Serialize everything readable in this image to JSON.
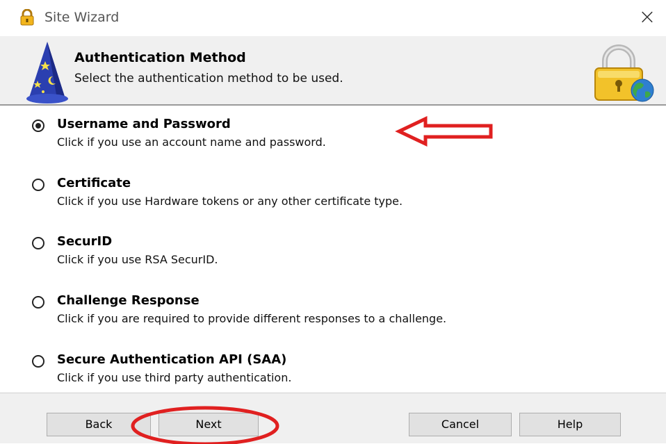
{
  "window": {
    "title": "Site Wizard",
    "close_glyph": "×"
  },
  "header": {
    "title": "Authentication Method",
    "subtitle": "Select the authentication method to be used.",
    "left_icon": "wizard-hat-icon",
    "right_icon": "lock-globe-icon"
  },
  "options": [
    {
      "label": "Username and Password",
      "description": "Click if you use an account name and password.",
      "selected": true
    },
    {
      "label": "Certificate",
      "description": "Click if you use Hardware tokens or any other certificate type.",
      "selected": false
    },
    {
      "label": "SecurID",
      "description": "Click if you use RSA SecurID.",
      "selected": false
    },
    {
      "label": "Challenge Response",
      "description": "Click if you are required to provide different responses to a challenge.",
      "selected": false
    },
    {
      "label": "Secure Authentication API (SAA)",
      "description": "Click if you use third party authentication.",
      "selected": false
    }
  ],
  "buttons": {
    "back": "Back",
    "next": "Next",
    "cancel": "Cancel",
    "help": "Help"
  },
  "annotation": {
    "color": "#e02020",
    "arrow_points_to": "Username and Password",
    "circled": "Next"
  }
}
